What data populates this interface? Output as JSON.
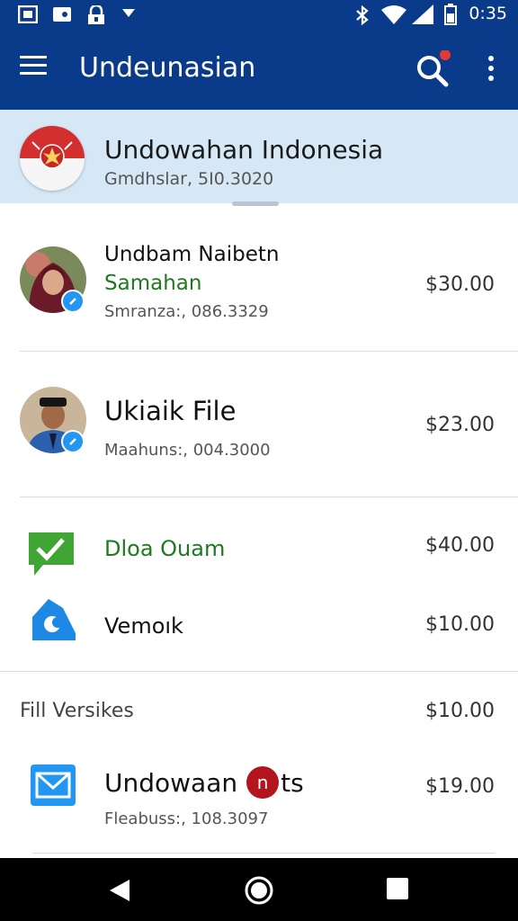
{
  "status_bar": {
    "time": "0:35"
  },
  "app_bar": {
    "title": "Undeunasian"
  },
  "header": {
    "title": "Undowahan Indonesia",
    "subtitle": "Gmdhslar, 5I0.3020"
  },
  "items": [
    {
      "name": "Undbam Naibetn",
      "secondary": "Samahan",
      "meta": "Smranza:, 086.3329",
      "price": "$30.00"
    },
    {
      "name": "Ukiaik File",
      "meta": "Maahuns:, 004.3000",
      "price": "$23.00"
    },
    {
      "name": "Dloa Ouam",
      "price": "$40.00"
    },
    {
      "name": "Vemoık",
      "price": "$10.00"
    },
    {
      "name": "Fill Versikes",
      "price": "$10.00"
    },
    {
      "name_before": "Undowaan",
      "name_badge": "n",
      "name_after": "ts",
      "meta": "Fleabuss:, 108.3097",
      "price": "$19.00"
    }
  ],
  "colors": {
    "primary": "#0a3a8a",
    "header_bg": "#d6e8f5",
    "accent_green": "#1e7a1e",
    "badge_blue": "#2196f3",
    "notification_red": "#e53935"
  },
  "icons": [
    "sim-icon",
    "photo-icon",
    "lock-icon",
    "dropdown-icon",
    "bluetooth-icon",
    "wifi-icon",
    "signal-icon",
    "battery-icon",
    "menu-icon",
    "search-icon",
    "more-icon",
    "check-message-icon",
    "cloud-icon",
    "mail-icon",
    "back-icon",
    "home-icon",
    "recents-icon"
  ]
}
